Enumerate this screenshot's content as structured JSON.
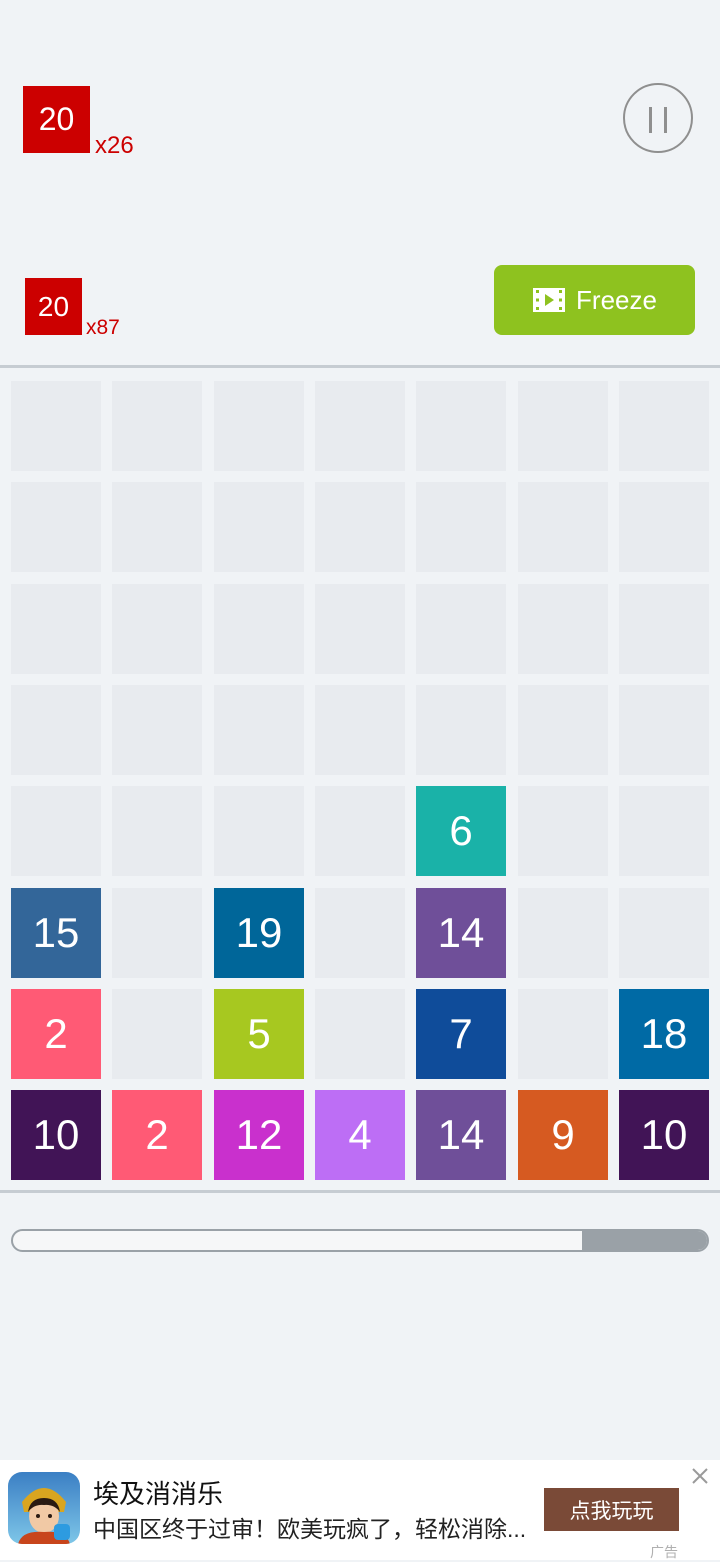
{
  "goals": [
    {
      "value": "20",
      "count": "x26"
    },
    {
      "value": "20",
      "count": "x87"
    }
  ],
  "freeze": {
    "label": "Freeze"
  },
  "colors": {
    "goal_red": "#cc0000",
    "freeze_green": "#8ec21f",
    "empty_cell": "#e8ebef"
  },
  "board": {
    "rows": 8,
    "cols": 7,
    "tiles": [
      {
        "row": 5,
        "col": 5,
        "value": "6",
        "color": "#1ab2a8"
      },
      {
        "row": 6,
        "col": 1,
        "value": "15",
        "color": "#336699"
      },
      {
        "row": 6,
        "col": 3,
        "value": "19",
        "color": "#006699"
      },
      {
        "row": 6,
        "col": 5,
        "value": "14",
        "color": "#6f4f99"
      },
      {
        "row": 7,
        "col": 1,
        "value": "2",
        "color": "#ff5a75"
      },
      {
        "row": 7,
        "col": 3,
        "value": "5",
        "color": "#a7c820"
      },
      {
        "row": 7,
        "col": 5,
        "value": "7",
        "color": "#0f4c9a"
      },
      {
        "row": 7,
        "col": 7,
        "value": "18",
        "color": "#006aa5"
      },
      {
        "row": 8,
        "col": 1,
        "value": "10",
        "color": "#411456"
      },
      {
        "row": 8,
        "col": 2,
        "value": "2",
        "color": "#ff5a75"
      },
      {
        "row": 8,
        "col": 3,
        "value": "12",
        "color": "#c930cd"
      },
      {
        "row": 8,
        "col": 4,
        "value": "4",
        "color": "#bd6ef5"
      },
      {
        "row": 8,
        "col": 5,
        "value": "14",
        "color": "#6f4f99"
      },
      {
        "row": 8,
        "col": 6,
        "value": "9",
        "color": "#d65a21"
      },
      {
        "row": 8,
        "col": 7,
        "value": "10",
        "color": "#411456"
      }
    ]
  },
  "timer": {
    "remaining_fraction": 0.82
  },
  "ad": {
    "title": "埃及消消乐",
    "description": "中国区终于过审！欧美玩疯了，轻松消除...",
    "cta": "点我玩玩",
    "label": "广告"
  }
}
